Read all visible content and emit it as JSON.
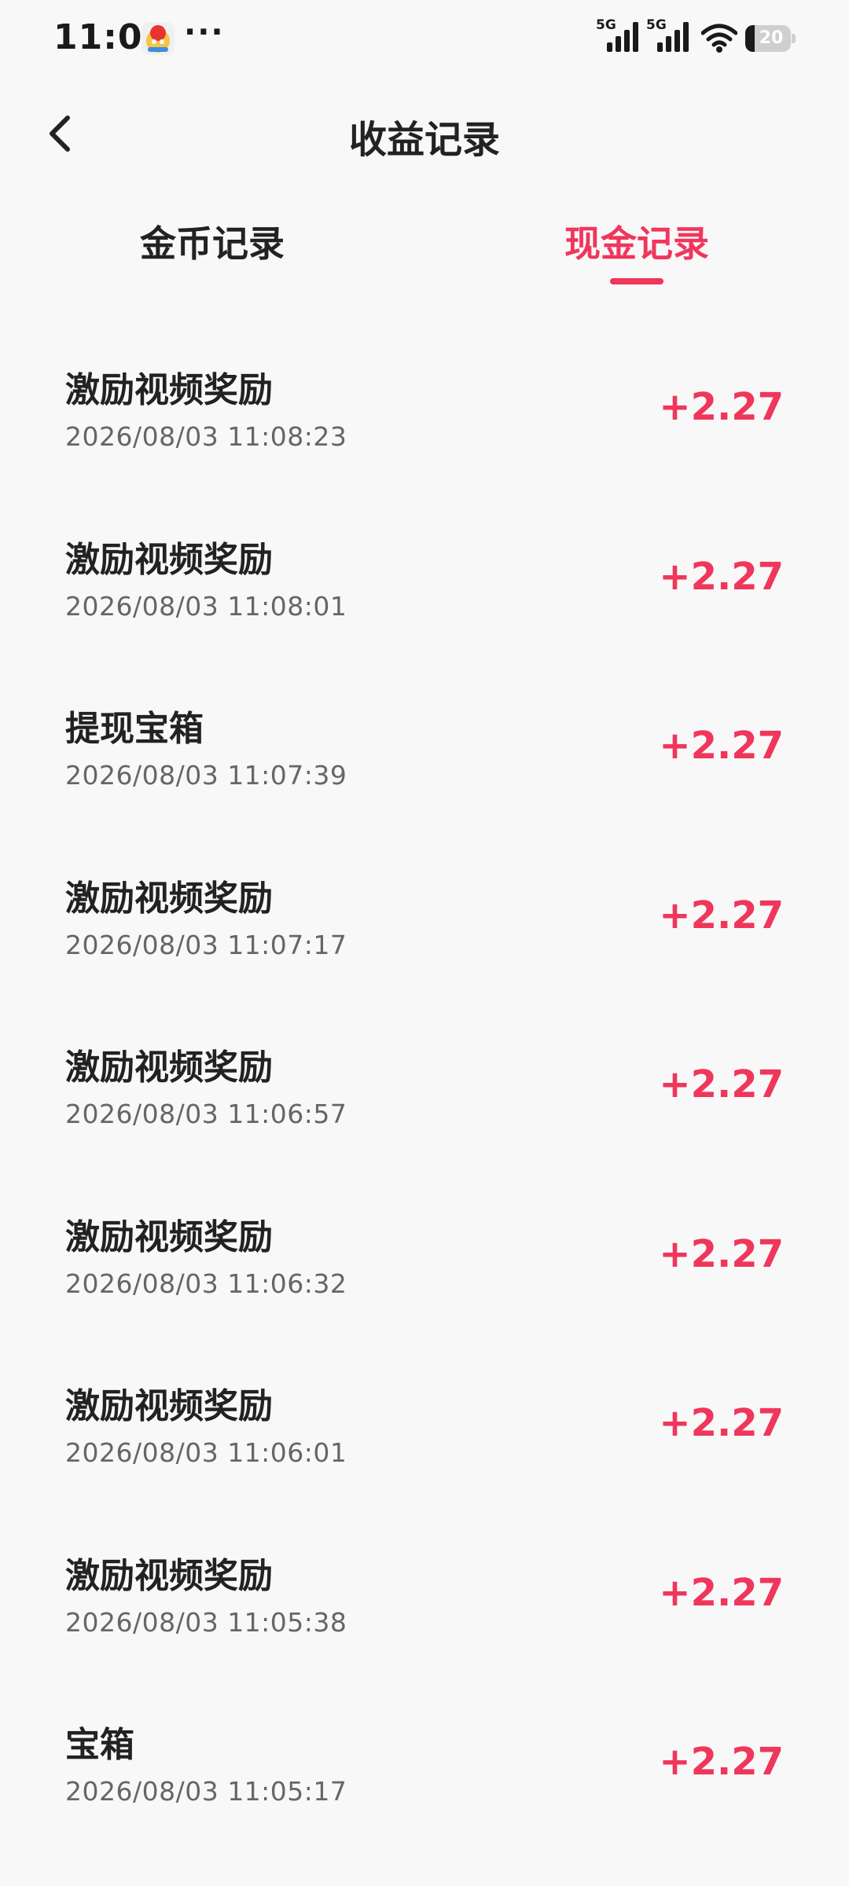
{
  "status_bar": {
    "time": "11:09",
    "dots": "···",
    "signal1_label": "5G",
    "signal2_label": "5G",
    "battery_level": "20",
    "battery_fraction": 0.2
  },
  "header": {
    "title": "收益记录",
    "back_icon": "chevron-left-icon"
  },
  "tabs": [
    {
      "label": "金币记录",
      "active": false
    },
    {
      "label": "现金记录",
      "active": true
    }
  ],
  "colors": {
    "accent": "#f0365b",
    "text_primary": "#222222",
    "text_secondary": "#666666",
    "background": "#f8f8f8"
  },
  "records": [
    {
      "title": "激励视频奖励",
      "time": "2026/08/03 11:08:23",
      "amount": "+2.27"
    },
    {
      "title": "激励视频奖励",
      "time": "2026/08/03 11:08:01",
      "amount": "+2.27"
    },
    {
      "title": "提现宝箱",
      "time": "2026/08/03 11:07:39",
      "amount": "+2.27"
    },
    {
      "title": "激励视频奖励",
      "time": "2026/08/03 11:07:17",
      "amount": "+2.27"
    },
    {
      "title": "激励视频奖励",
      "time": "2026/08/03 11:06:57",
      "amount": "+2.27"
    },
    {
      "title": "激励视频奖励",
      "time": "2026/08/03 11:06:32",
      "amount": "+2.27"
    },
    {
      "title": "激励视频奖励",
      "time": "2026/08/03 11:06:01",
      "amount": "+2.27"
    },
    {
      "title": "激励视频奖励",
      "time": "2026/08/03 11:05:38",
      "amount": "+2.27"
    },
    {
      "title": "宝箱",
      "time": "2026/08/03 11:05:17",
      "amount": "+2.27"
    }
  ]
}
